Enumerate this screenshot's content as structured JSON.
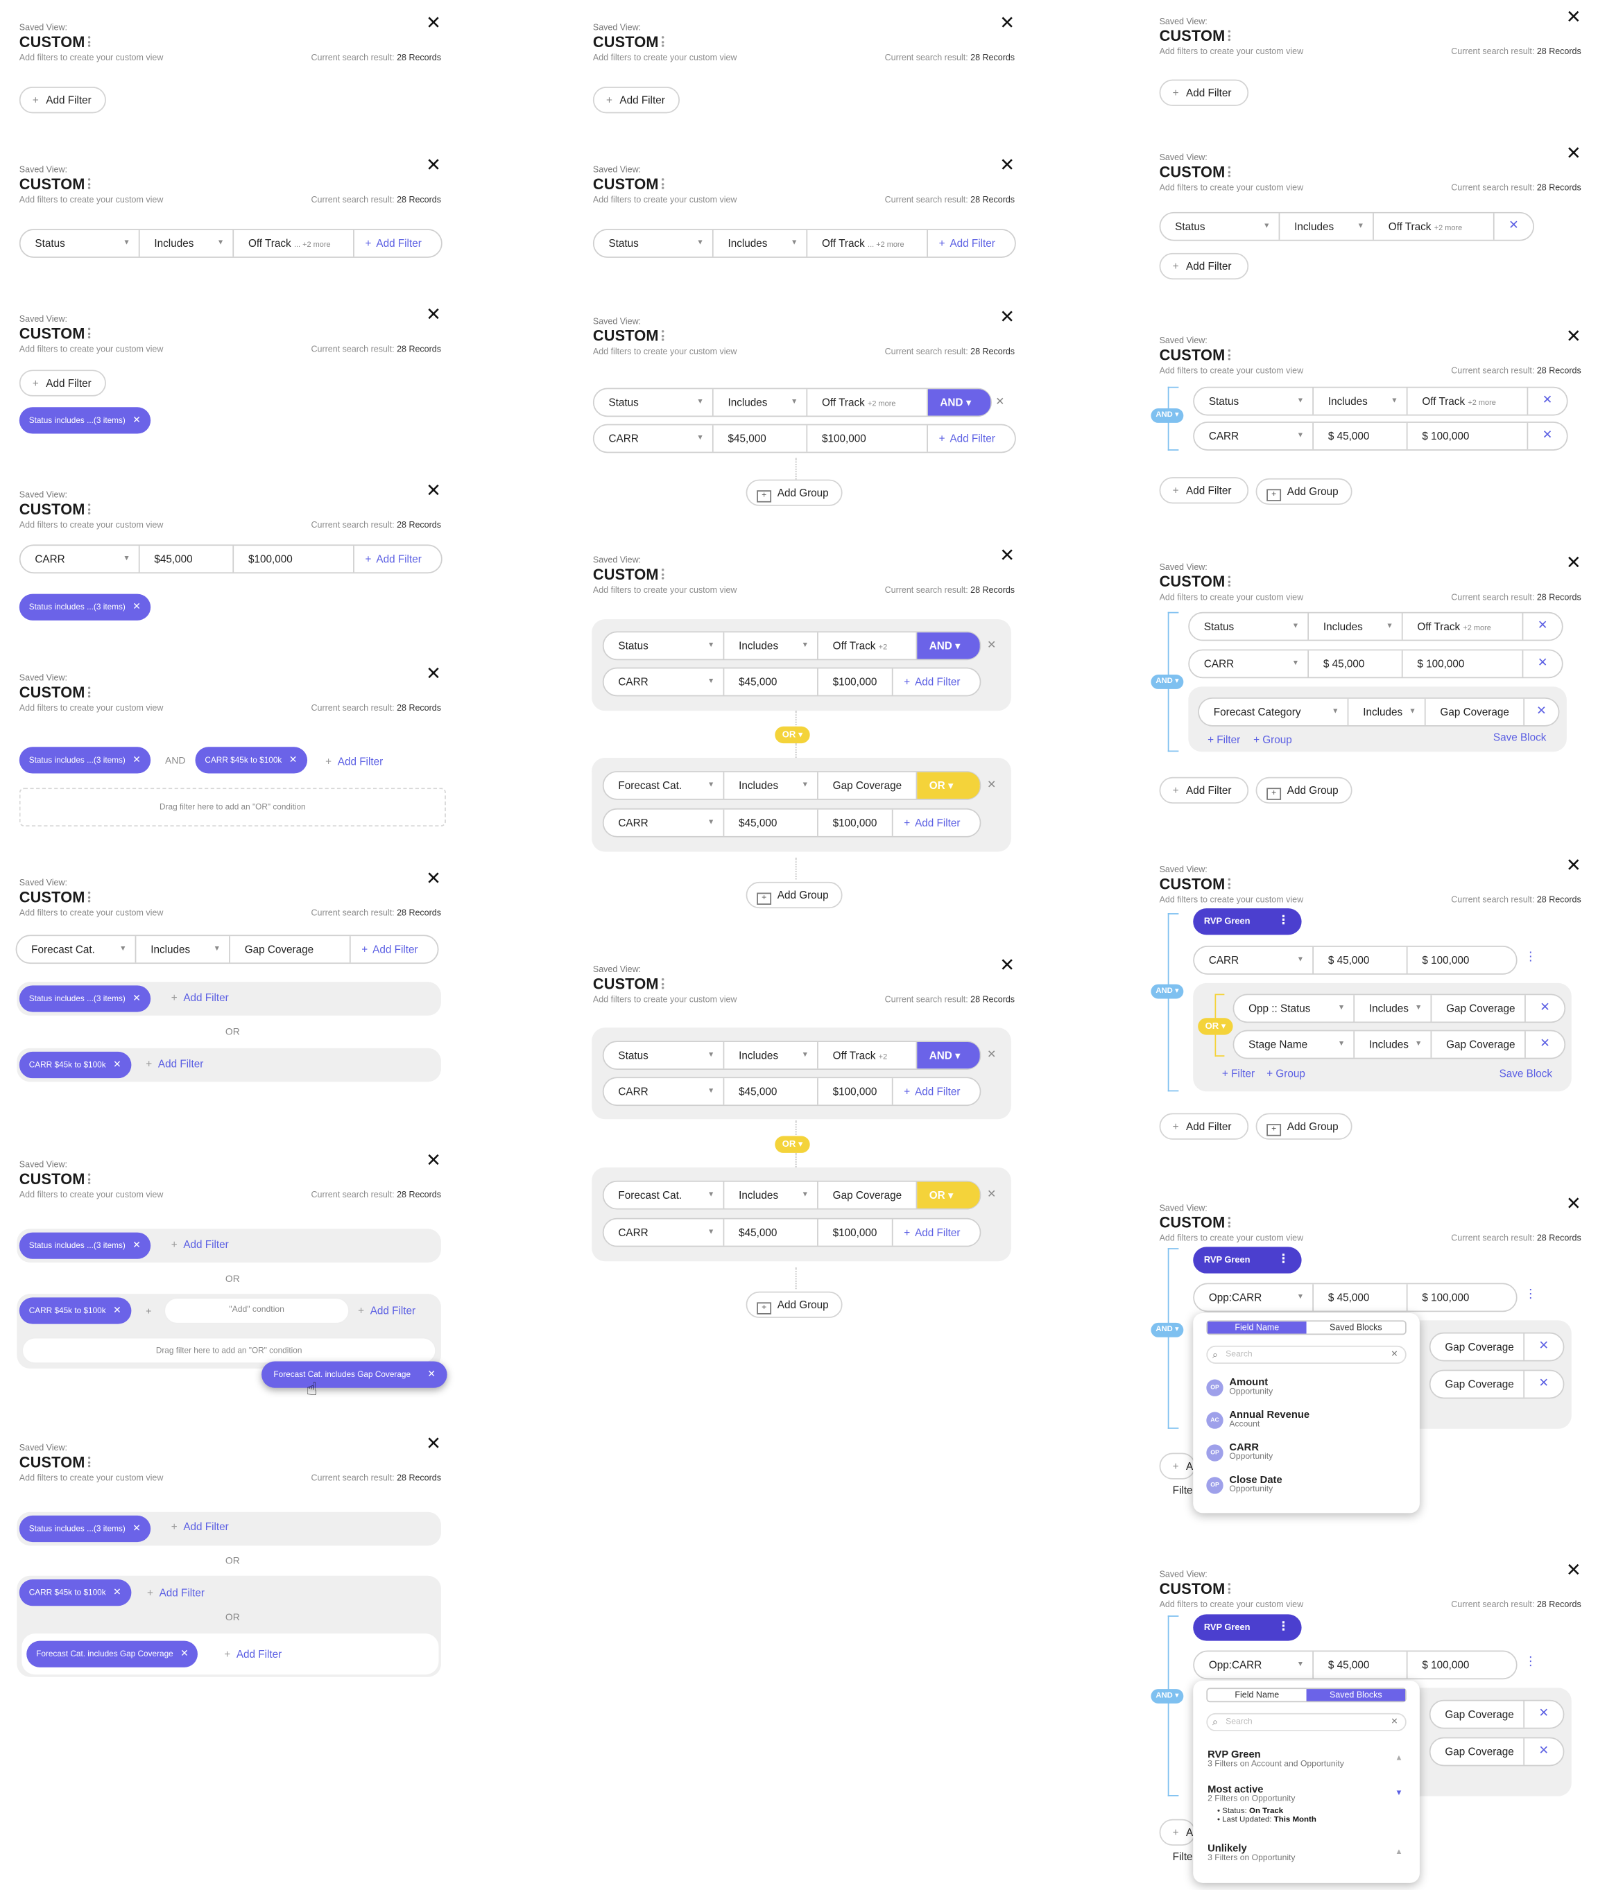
{
  "common": {
    "saved_view_label": "Saved View:",
    "view_name": "CUSTOM",
    "subtitle": "Add filters to create your custom view",
    "result_prefix": "Current search result:",
    "result_count": "28 Records",
    "close_glyph": "✕"
  },
  "labels": {
    "add_filter": "Add Filter",
    "add_group": "Add Group",
    "status": "Status",
    "includes": "Includes",
    "off_track": "Off Track",
    "off_track_more_1": "... +2 more",
    "more_2": "+2 more",
    "more_short": "+2",
    "carr": "CARR",
    "opp_carr": "Opp:CARR",
    "v45": "$45,000",
    "v100": "$100,000",
    "v45s": "$ 45,000",
    "v100s": "$ 100,000",
    "forecast_cat": "Forecast Cat.",
    "forecast_category": "Forecast Category",
    "gap_coverage": "Gap Coverage",
    "and": "AND",
    "or": "OR",
    "and_badge": "AND ▾",
    "or_badge": "OR ▾",
    "status_pill": "Status includes ...(3 items)",
    "carr_pill": "CARR $45k to $100k",
    "forecast_pill": "Forecast Cat. includes Gap Coverage",
    "drag_hint": "Drag filter here to add an \"OR\" condition",
    "add_condition": "\"Add\" condtion",
    "plus_filter": "+ Filter",
    "plus_group": "+ Group",
    "save_block": "Save Block",
    "rvp_green": "RVP Green",
    "opp_status": "Opp :: Status",
    "stage_name": "Stage Name"
  },
  "popup_field": {
    "tabs": [
      "Field Name",
      "Saved Blocks"
    ],
    "active_tab": "Field Name",
    "search_placeholder": "Search",
    "items": [
      {
        "avatar": "OP",
        "name": "Amount",
        "object": "Opportunity"
      },
      {
        "avatar": "AC",
        "name": "Annual Revenue",
        "object": "Account"
      },
      {
        "avatar": "OP",
        "name": "CARR",
        "object": "Opportunity"
      },
      {
        "avatar": "OP",
        "name": "Close Date",
        "object": "Opportunity"
      }
    ]
  },
  "popup_blocks": {
    "tabs": [
      "Field Name",
      "Saved Blocks"
    ],
    "active_tab": "Saved Blocks",
    "search_placeholder": "Search",
    "items": [
      {
        "name": "RVP Green",
        "desc": "3 Filters on Account and Opportunity"
      },
      {
        "name": "Most active",
        "desc": "2 Filters on Opportunity",
        "details": [
          {
            "label": "Status:",
            "value": "On Track"
          },
          {
            "label": "Last Updated:",
            "value": "This Month"
          }
        ]
      },
      {
        "name": "Unlikely",
        "desc": "3 Filters on Opportunity"
      }
    ]
  },
  "icons": {
    "close": "close-icon",
    "plus": "plus-icon",
    "chevron": "chevron-down-icon",
    "kebab": "kebab-icon",
    "group": "group-icon",
    "search": "search-icon",
    "cursor": "hand-cursor-icon"
  },
  "colors": {
    "accent": "#6b63e8",
    "dark_accent": "#4b3fcf",
    "or_yellow": "#f4d33a",
    "and_blue": "#7ec0f0"
  }
}
